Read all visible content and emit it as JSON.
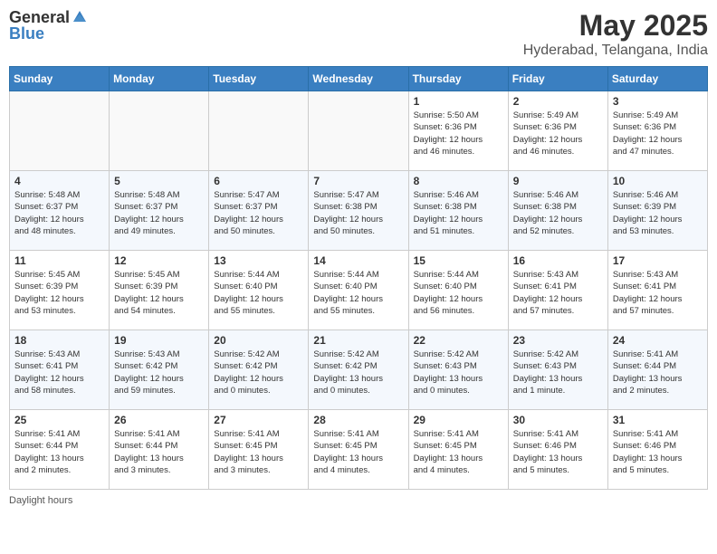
{
  "header": {
    "logo_general": "General",
    "logo_blue": "Blue",
    "title": "May 2025",
    "location": "Hyderabad, Telangana, India"
  },
  "weekdays": [
    "Sunday",
    "Monday",
    "Tuesday",
    "Wednesday",
    "Thursday",
    "Friday",
    "Saturday"
  ],
  "weeks": [
    [
      {
        "day": "",
        "info": ""
      },
      {
        "day": "",
        "info": ""
      },
      {
        "day": "",
        "info": ""
      },
      {
        "day": "",
        "info": ""
      },
      {
        "day": "1",
        "info": "Sunrise: 5:50 AM\nSunset: 6:36 PM\nDaylight: 12 hours\nand 46 minutes."
      },
      {
        "day": "2",
        "info": "Sunrise: 5:49 AM\nSunset: 6:36 PM\nDaylight: 12 hours\nand 46 minutes."
      },
      {
        "day": "3",
        "info": "Sunrise: 5:49 AM\nSunset: 6:36 PM\nDaylight: 12 hours\nand 47 minutes."
      }
    ],
    [
      {
        "day": "4",
        "info": "Sunrise: 5:48 AM\nSunset: 6:37 PM\nDaylight: 12 hours\nand 48 minutes."
      },
      {
        "day": "5",
        "info": "Sunrise: 5:48 AM\nSunset: 6:37 PM\nDaylight: 12 hours\nand 49 minutes."
      },
      {
        "day": "6",
        "info": "Sunrise: 5:47 AM\nSunset: 6:37 PM\nDaylight: 12 hours\nand 50 minutes."
      },
      {
        "day": "7",
        "info": "Sunrise: 5:47 AM\nSunset: 6:38 PM\nDaylight: 12 hours\nand 50 minutes."
      },
      {
        "day": "8",
        "info": "Sunrise: 5:46 AM\nSunset: 6:38 PM\nDaylight: 12 hours\nand 51 minutes."
      },
      {
        "day": "9",
        "info": "Sunrise: 5:46 AM\nSunset: 6:38 PM\nDaylight: 12 hours\nand 52 minutes."
      },
      {
        "day": "10",
        "info": "Sunrise: 5:46 AM\nSunset: 6:39 PM\nDaylight: 12 hours\nand 53 minutes."
      }
    ],
    [
      {
        "day": "11",
        "info": "Sunrise: 5:45 AM\nSunset: 6:39 PM\nDaylight: 12 hours\nand 53 minutes."
      },
      {
        "day": "12",
        "info": "Sunrise: 5:45 AM\nSunset: 6:39 PM\nDaylight: 12 hours\nand 54 minutes."
      },
      {
        "day": "13",
        "info": "Sunrise: 5:44 AM\nSunset: 6:40 PM\nDaylight: 12 hours\nand 55 minutes."
      },
      {
        "day": "14",
        "info": "Sunrise: 5:44 AM\nSunset: 6:40 PM\nDaylight: 12 hours\nand 55 minutes."
      },
      {
        "day": "15",
        "info": "Sunrise: 5:44 AM\nSunset: 6:40 PM\nDaylight: 12 hours\nand 56 minutes."
      },
      {
        "day": "16",
        "info": "Sunrise: 5:43 AM\nSunset: 6:41 PM\nDaylight: 12 hours\nand 57 minutes."
      },
      {
        "day": "17",
        "info": "Sunrise: 5:43 AM\nSunset: 6:41 PM\nDaylight: 12 hours\nand 57 minutes."
      }
    ],
    [
      {
        "day": "18",
        "info": "Sunrise: 5:43 AM\nSunset: 6:41 PM\nDaylight: 12 hours\nand 58 minutes."
      },
      {
        "day": "19",
        "info": "Sunrise: 5:43 AM\nSunset: 6:42 PM\nDaylight: 12 hours\nand 59 minutes."
      },
      {
        "day": "20",
        "info": "Sunrise: 5:42 AM\nSunset: 6:42 PM\nDaylight: 12 hours\nand 0 minutes."
      },
      {
        "day": "21",
        "info": "Sunrise: 5:42 AM\nSunset: 6:42 PM\nDaylight: 13 hours\nand 0 minutes."
      },
      {
        "day": "22",
        "info": "Sunrise: 5:42 AM\nSunset: 6:43 PM\nDaylight: 13 hours\nand 0 minutes."
      },
      {
        "day": "23",
        "info": "Sunrise: 5:42 AM\nSunset: 6:43 PM\nDaylight: 13 hours\nand 1 minute."
      },
      {
        "day": "24",
        "info": "Sunrise: 5:41 AM\nSunset: 6:44 PM\nDaylight: 13 hours\nand 2 minutes."
      }
    ],
    [
      {
        "day": "25",
        "info": "Sunrise: 5:41 AM\nSunset: 6:44 PM\nDaylight: 13 hours\nand 2 minutes."
      },
      {
        "day": "26",
        "info": "Sunrise: 5:41 AM\nSunset: 6:44 PM\nDaylight: 13 hours\nand 3 minutes."
      },
      {
        "day": "27",
        "info": "Sunrise: 5:41 AM\nSunset: 6:45 PM\nDaylight: 13 hours\nand 3 minutes."
      },
      {
        "day": "28",
        "info": "Sunrise: 5:41 AM\nSunset: 6:45 PM\nDaylight: 13 hours\nand 4 minutes."
      },
      {
        "day": "29",
        "info": "Sunrise: 5:41 AM\nSunset: 6:45 PM\nDaylight: 13 hours\nand 4 minutes."
      },
      {
        "day": "30",
        "info": "Sunrise: 5:41 AM\nSunset: 6:46 PM\nDaylight: 13 hours\nand 5 minutes."
      },
      {
        "day": "31",
        "info": "Sunrise: 5:41 AM\nSunset: 6:46 PM\nDaylight: 13 hours\nand 5 minutes."
      }
    ]
  ],
  "footer": {
    "daylight_label": "Daylight hours"
  }
}
